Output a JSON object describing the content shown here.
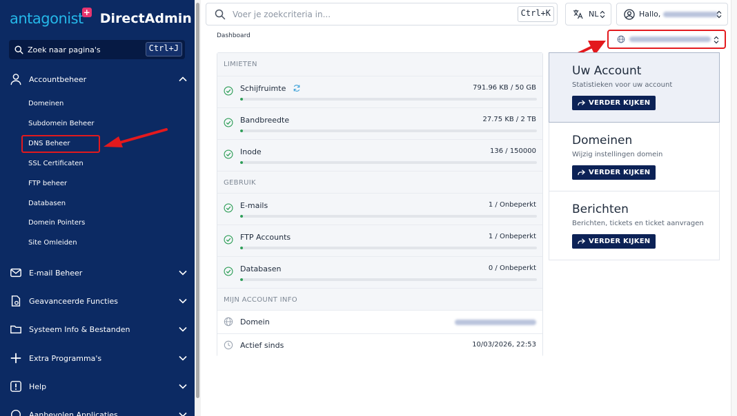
{
  "brand": {
    "logo_text": "antagonist",
    "product": "DirectAdmin"
  },
  "sidebar": {
    "search_label": "Zoek naar pagina's",
    "search_shortcut": "Ctrl+J",
    "account_label": "Accountbeheer",
    "account_items": [
      {
        "label": "Domeinen"
      },
      {
        "label": "Subdomein Beheer"
      },
      {
        "label": "DNS Beheer"
      },
      {
        "label": "SSL Certificaten"
      },
      {
        "label": "FTP beheer"
      },
      {
        "label": "Databasen"
      },
      {
        "label": "Domein Pointers"
      },
      {
        "label": "Site Omleiden"
      }
    ],
    "sections": [
      {
        "label": "E-mail Beheer",
        "icon": "envelope-icon"
      },
      {
        "label": "Geavanceerde Functies",
        "icon": "document-gear-icon"
      },
      {
        "label": "Systeem Info & Bestanden",
        "icon": "folder-icon"
      },
      {
        "label": "Extra Programma's",
        "icon": "plus-icon"
      },
      {
        "label": "Help",
        "icon": "exclamation-icon"
      },
      {
        "label": "Aanbevolen Applicaties",
        "icon": "apps-icon"
      }
    ]
  },
  "topbar": {
    "search_placeholder": "Voer je zoekcriteria in...",
    "search_shortcut": "Ctrl+K",
    "language": "NL",
    "greeting": "Hallo,"
  },
  "breadcrumb": "Dashboard",
  "stats": {
    "limits_header": "LIMIETEN",
    "usage_header": "GEBRUIK",
    "info_header": "MIJN ACCOUNT INFO",
    "limits": [
      {
        "name": "Schijfruimte",
        "value": "791.96 KB / 50 GB",
        "percent": 0.02
      },
      {
        "name": "Bandbreedte",
        "value": "27.75 KB / 2 TB",
        "percent": 0.0
      },
      {
        "name": "Inode",
        "value": "136 / 150000",
        "percent": 0.09
      }
    ],
    "usage": [
      {
        "name": "E-mails",
        "value": "1 / Onbeperkt",
        "percent": 0.0
      },
      {
        "name": "FTP Accounts",
        "value": "1 / Onbeperkt",
        "percent": 0.0
      },
      {
        "name": "Databasen",
        "value": "0 / Onbeperkt",
        "percent": 0.0
      }
    ],
    "info": {
      "domain_label": "Domein",
      "since_label": "Actief sinds",
      "since_value": "10/03/2026, 22:53"
    }
  },
  "panels": [
    {
      "title": "Uw Account",
      "desc": "Statistieken voor uw account",
      "button": "VERDER KIJKEN"
    },
    {
      "title": "Domeinen",
      "desc": "Wijzig instellingen domein",
      "button": "VERDER KIJKEN"
    },
    {
      "title": "Berichten",
      "desc": "Berichten, tickets en ticket aanvragen",
      "button": "VERDER KIJKEN"
    }
  ],
  "colors": {
    "sidebar_bg": "#0c2a63",
    "accent_green": "#2e9e57",
    "highlight_red": "#e3191d",
    "button_navy": "#0c2256"
  }
}
